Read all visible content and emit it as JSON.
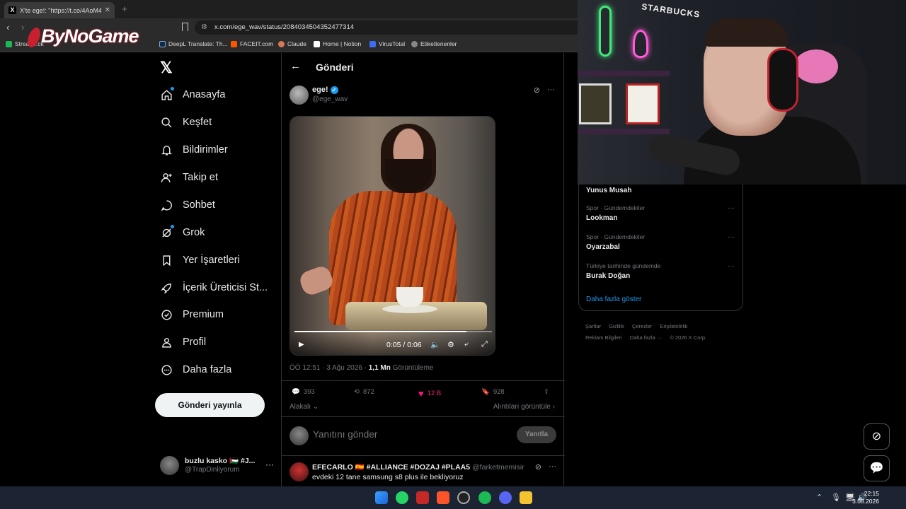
{
  "browser": {
    "tab_title": "X'te ege!: \"https://t.co/4AoM4d",
    "tab_favicon": "X",
    "url": "x.com/ege_wav/status/2084034504352477314",
    "bookmarks": [
      {
        "label": "Stream..ck",
        "color": "#1db954"
      },
      {
        "label": "DeepL Translate: Th...",
        "color": "#0f2b46"
      },
      {
        "label": "FACEIT.com",
        "color": "#ff5500"
      },
      {
        "label": "Claude",
        "color": "#d97757"
      },
      {
        "label": "Home | Notion",
        "color": "#ffffff"
      },
      {
        "label": "VirusTotal",
        "color": "#3a6df0"
      },
      {
        "label": "Etiketlenenler",
        "color": "#888888"
      }
    ]
  },
  "watermark": "ByNoGame",
  "sidebar": {
    "items": [
      {
        "label": "Anasayfa",
        "icon": "home-icon"
      },
      {
        "label": "Keşfet",
        "icon": "search-icon"
      },
      {
        "label": "Bildirimler",
        "icon": "bell-icon"
      },
      {
        "label": "Takip et",
        "icon": "person-add-icon"
      },
      {
        "label": "Sohbet",
        "icon": "chat-icon"
      },
      {
        "label": "Grok",
        "icon": "grok-icon"
      },
      {
        "label": "Yer İşaretleri",
        "icon": "bookmark-icon"
      },
      {
        "label": "İçerik Üreticisi St...",
        "icon": "rocket-icon"
      },
      {
        "label": "Premium",
        "icon": "premium-icon"
      },
      {
        "label": "Profil",
        "icon": "profile-icon"
      },
      {
        "label": "Daha fazla",
        "icon": "more-circle-icon"
      }
    ],
    "post_button": "Gönderi yayınla",
    "account": {
      "name": "buzlu kasko 🇵🇸 #J...",
      "handle": "@TrapDinliyorum"
    }
  },
  "post": {
    "header_title": "Gönderi",
    "author_name": "ege!",
    "author_handle": "@ege_wav",
    "video_time": "0:05 / 0:06",
    "video_progress": 0.87,
    "timestamp": "ÖÖ 12:51 · 3 Ağu 2026 · ",
    "views_count": "1,1 Mn",
    "views_label": " Görüntüleme",
    "replies": "393",
    "reposts": "872",
    "likes": "12 B",
    "bookmarks": "928",
    "filter_label": "Alakalı",
    "quotes_label": "Alıntıları görüntüle",
    "reply_placeholder": "Yanıtını gönder",
    "reply_button": "Yanıtla"
  },
  "reply": {
    "name": "EFECARLO 🇪🇸 #ALLIANCE #DOZAJ #PLAA5",
    "handle": " @farketmemisim · 8s",
    "text": "evdeki 12 tane samsung s8 plus ile bekliyoruz"
  },
  "trends": [
    {
      "category": "",
      "name": "Yunus Musah"
    },
    {
      "category": "Spor · Gündemdekiler",
      "name": "Lookman"
    },
    {
      "category": "Spor · Gündemdekiler",
      "name": "Oyarzabal"
    },
    {
      "category": "Türkiye tarihinde gündemde",
      "name": "Burak Doğan"
    }
  ],
  "trends_show_more": "Daha fazla göster",
  "footer_links": [
    "Şartlar",
    "Gizlilik",
    "Çerezler",
    "Erişilebilirlik",
    "Reklam Bilgileri",
    "Daha fazla ···",
    "© 2026 X Corp."
  ],
  "webcam_sign": "STARBUCKS",
  "taskbar": {
    "time": "22:15",
    "date": "3.08.2026"
  }
}
